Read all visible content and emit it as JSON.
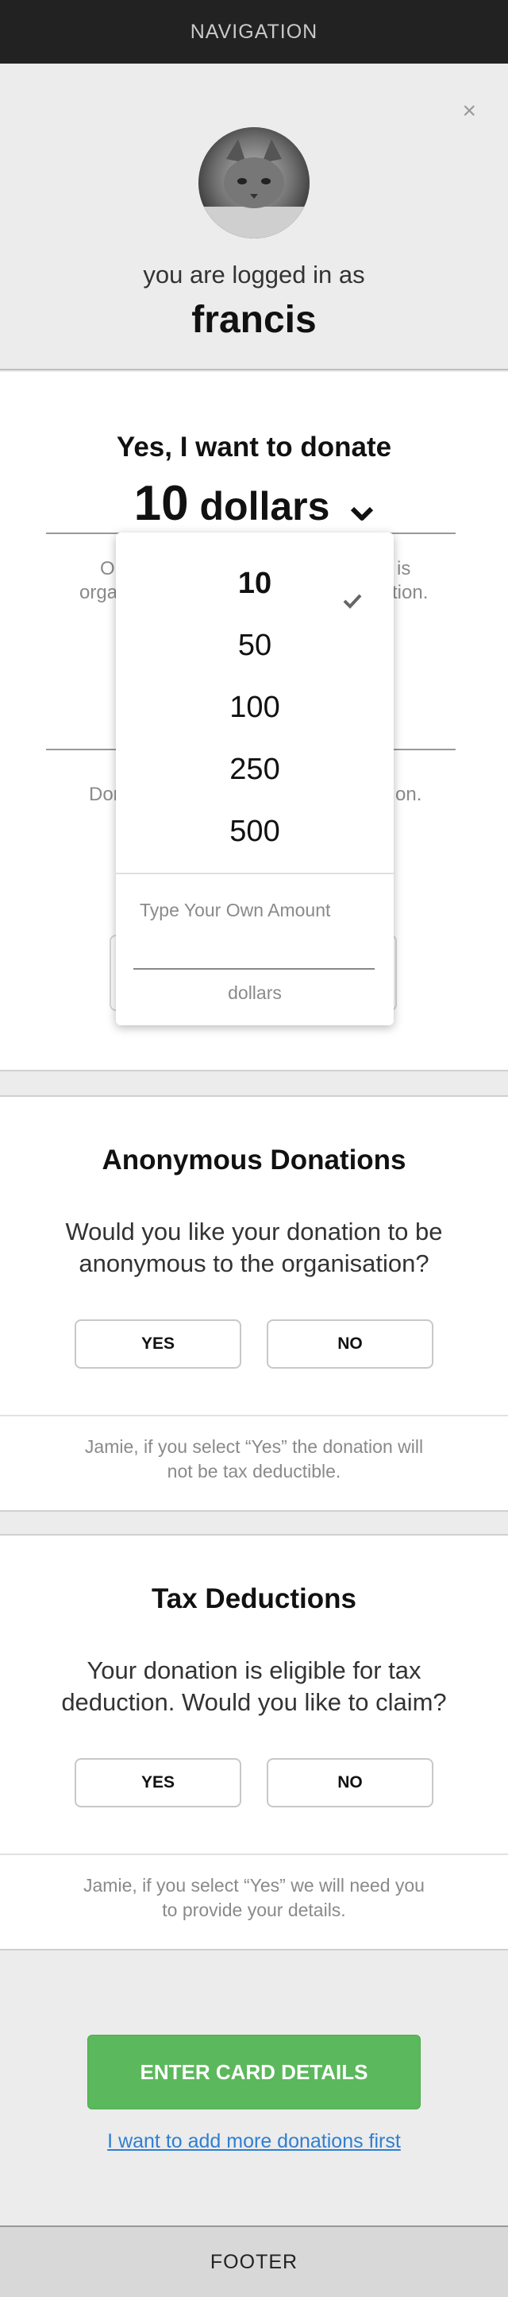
{
  "nav": {
    "title": "NAVIGATION"
  },
  "profile": {
    "close_glyph": "×",
    "logged_in_text": "you are logged in as",
    "username": "francis"
  },
  "donate": {
    "title": "Yes, I want to donate",
    "amount_value": "10",
    "amount_unit": "dollars",
    "behind_text_1_left": "O",
    "behind_text_1_right": "is",
    "behind_text_2_left": "orga",
    "behind_text_2_right": "tion.",
    "behind_text_3_left": "Don",
    "behind_text_3_right": "on."
  },
  "dropdown": {
    "options": [
      "10",
      "50",
      "100",
      "250",
      "500"
    ],
    "selected": "10",
    "custom_label": "Type Your Own Amount",
    "custom_unit": "dollars"
  },
  "anonymous": {
    "title": "Anonymous Donations",
    "question": "Would you like your donation to be anonymous to the organisation?",
    "yes_label": "YES",
    "no_label": "NO",
    "note": "Jamie, if you select “Yes” the donation will not be tax deductible."
  },
  "tax": {
    "title": "Tax Deductions",
    "question": "Your donation is eligible for tax deduction. Would you like to claim?",
    "yes_label": "YES",
    "no_label": "NO",
    "note": "Jamie, if you select “Yes” we will need you to provide your details."
  },
  "cta": {
    "label": "ENTER CARD DETAILS"
  },
  "more_link": {
    "label": "I want to add more donations first"
  },
  "footer": {
    "label": "FOOTER"
  },
  "colors": {
    "cta_green": "#5cb85c",
    "link_blue": "#2f7fd1",
    "nav_bg": "#222222"
  },
  "icons": [
    "close-icon",
    "avatar-cat-image",
    "chevron-down-icon",
    "checkmark-icon"
  ]
}
